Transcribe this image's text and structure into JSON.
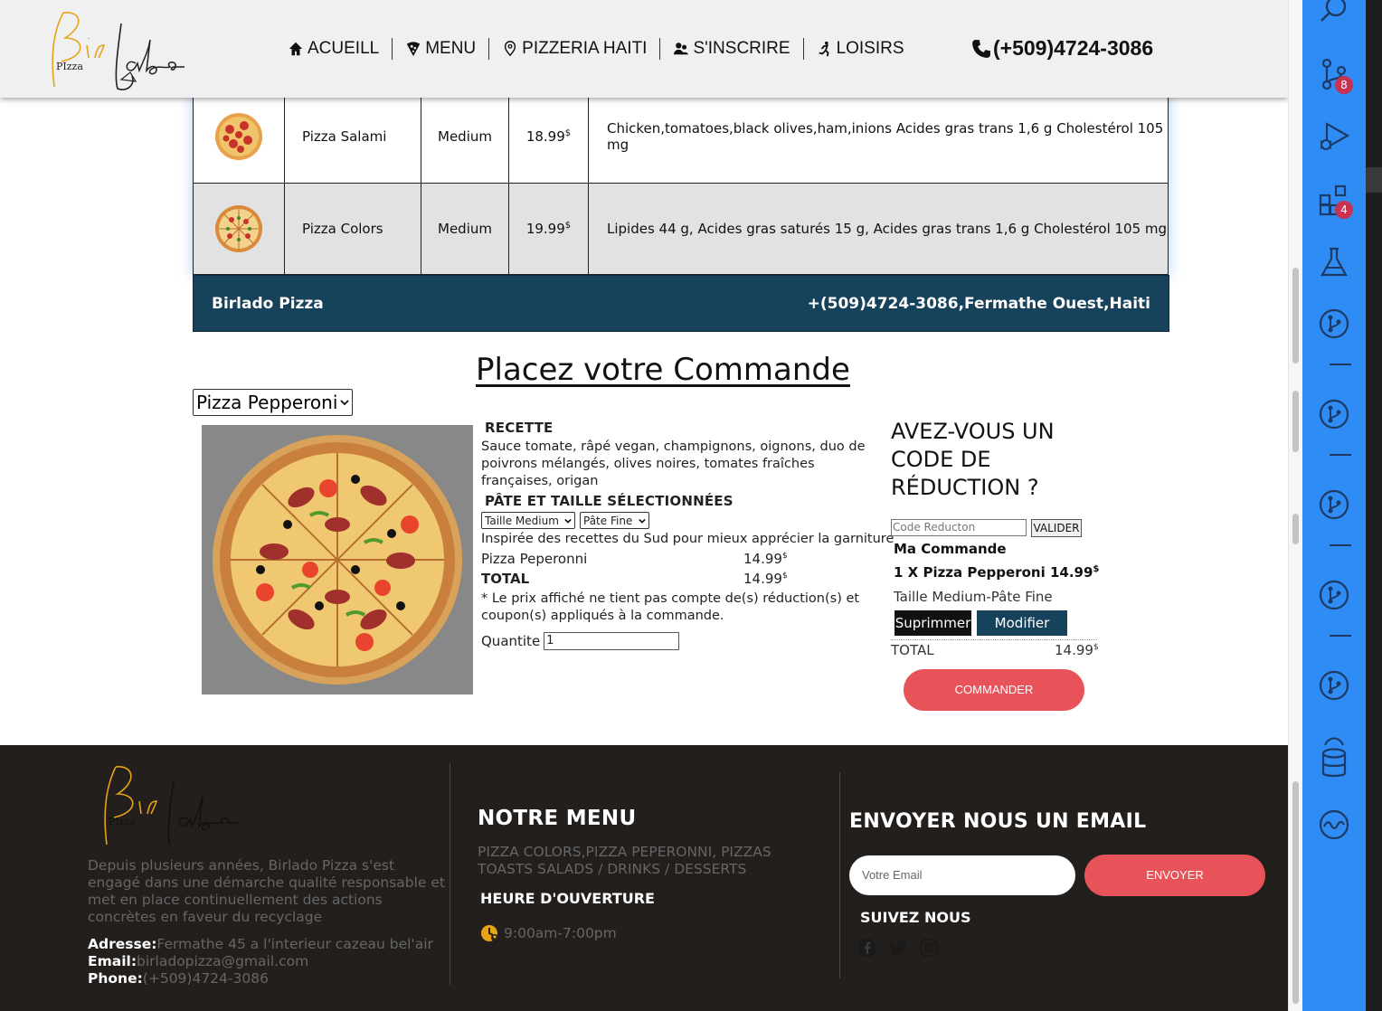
{
  "header": {
    "nav": [
      {
        "label": "ACUEILL",
        "icon": "home-icon"
      },
      {
        "label": "MENU",
        "icon": "pizza-slice-icon"
      },
      {
        "label": "PIZZERIA HAITI",
        "icon": "map-pin-icon"
      },
      {
        "label": "S'INSCRIRE",
        "icon": "users-icon"
      },
      {
        "label": "LOISIRS",
        "icon": "running-icon"
      }
    ],
    "phone": "(+509)4724-3086",
    "phone_icon": "phone-icon"
  },
  "menu_table": {
    "rows": [
      {
        "name": "Pizza Salami",
        "size": "Medium",
        "price": "18.99",
        "currency": "$",
        "description": "Chicken,tomatoes,black olives,ham,inions Acides gras trans 1,6 g Cholestérol 105 mg"
      },
      {
        "name": "Pizza Colors",
        "size": "Medium",
        "price": "19.99",
        "currency": "$",
        "description": "Lipides 44 g, Acides gras saturés 15 g, Acides gras trans 1,6 g Cholestérol 105 mg"
      }
    ],
    "footer_left": "Birlado Pizza",
    "footer_right": "+(509)4724-3086,Fermathe Ouest,Haiti"
  },
  "order": {
    "title": "Placez votre Commande",
    "selected_pizza": "Pizza Pepperoni",
    "recipe_heading": "RECETTE",
    "recipe_text": "Sauce tomate, râpé vegan, champignons, oignons, duo de poivrons mélangés, olives noires, tomates fraîches françaises, origan",
    "size_heading": "PÂTE ET TAILLE SÉLECTIONNÉES",
    "size_select": "Taille Medium",
    "dough_select": "Pâte Fine",
    "inspired_text": "Inspirée des recettes du Sud pour mieux apprécier la garniture",
    "item_label": "Pizza Peperonni",
    "item_price": "14.99",
    "total_label": "TOTAL",
    "total_price": "14.99",
    "currency": "$",
    "disclaimer": "* Le prix affiché ne tient pas compte de(s) réduction(s) et coupon(s) appliqués à la commande.",
    "quantity_label": "Quantite",
    "quantity_value": "1"
  },
  "promo": {
    "title": "AVEZ-VOUS UN CODE DE RÉDUCTION ?",
    "code_placeholder": "Code Reducton",
    "validate_label": "VALIDER",
    "my_order": "Ma Commande",
    "order_line": "1 X Pizza Pepperoni 14.99",
    "order_line_currency": "$",
    "order_detail": "Taille Medium-Pâte Fine",
    "delete_label": "Suprimmer",
    "modify_label": "Modifier",
    "total_label": "TOTAL",
    "total_value": "14.99",
    "currency": "$",
    "order_button": "COMMANDER"
  },
  "footer": {
    "about": "Depuis plusieurs années, Birlado Pizza s'est engagé dans une démarche qualité responsable et met en place continuellement des actions concrètes en faveur du recyclage",
    "address_label": "Adresse:",
    "address": "Fermathe 45 a l'interieur cazeau bel'air",
    "email_label": "Email:",
    "email": "birladopizza@gmail.com",
    "phone_label": "Phone:",
    "phone": "(+509)4724-3086",
    "menu_heading": "NOTRE MENU",
    "menu_text": "PIZZA COLORS,PIZZA PEPERONNI, PIZZAS TOASTS SALADS / DRINKS / DESSERTS",
    "hours_heading": "HEURE D'OUVERTURE",
    "hours": "9:00am-7:00pm",
    "email_heading": "ENVOYER NOUS UN EMAIL",
    "email_placeholder": "Votre Email",
    "send_label": "ENVOYER",
    "follow_heading": "SUIVEZ NOUS",
    "social": [
      "facebook-icon",
      "twitter-icon",
      "instagram-icon"
    ]
  },
  "logo": {
    "text_main": "Birlado",
    "text_pizza": "PIzza"
  },
  "activity_bar": {
    "badges": {
      "source_control": "8",
      "extensions": "4"
    },
    "icons": [
      "search-icon",
      "source-control-icon",
      "run-debug-icon",
      "extensions-icon",
      "testing-icon",
      "git-graph-icon",
      "database-icon",
      "wave-icon"
    ]
  },
  "colors": {
    "brand_blue": "#16425b",
    "accent_red": "#e8535a",
    "logo_gold": "#e6a317",
    "footer_bg": "#231f1d",
    "activity_blue": "#2f8cf5",
    "badge": "#c8314f"
  }
}
